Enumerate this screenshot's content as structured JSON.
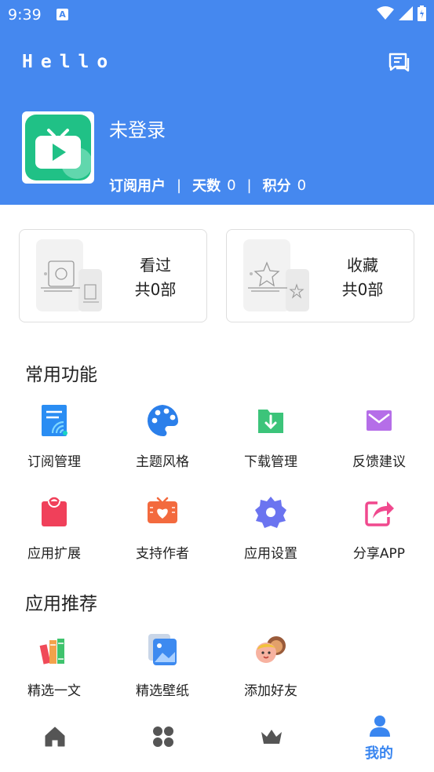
{
  "status_bar": {
    "time": "9:39",
    "notif": "A"
  },
  "header": {
    "title": "Hello",
    "user": {
      "name": "未登录"
    },
    "stats": {
      "type_label": "订阅用户",
      "days_label": "天数",
      "days_value": "0",
      "points_label": "积分",
      "points_value": "0"
    }
  },
  "cards": [
    {
      "title": "看过",
      "count": "共0部"
    },
    {
      "title": "收藏",
      "count": "共0部"
    }
  ],
  "common_functions": {
    "title": "常用功能",
    "items": [
      {
        "label": "订阅管理",
        "icon": "subscription-icon"
      },
      {
        "label": "主题风格",
        "icon": "palette-icon"
      },
      {
        "label": "下载管理",
        "icon": "download-folder-icon"
      },
      {
        "label": "反馈建议",
        "icon": "mail-icon"
      },
      {
        "label": "应用扩展",
        "icon": "bag-icon"
      },
      {
        "label": "支持作者",
        "icon": "heart-tv-icon"
      },
      {
        "label": "应用设置",
        "icon": "settings-gear-icon"
      },
      {
        "label": "分享APP",
        "icon": "share-icon"
      }
    ]
  },
  "recommend": {
    "title": "应用推荐",
    "items": [
      {
        "label": "精选一文",
        "icon": "books-icon"
      },
      {
        "label": "精选壁纸",
        "icon": "wallpaper-icon"
      },
      {
        "label": "添加好友",
        "icon": "friends-icon"
      }
    ]
  },
  "tabbar": {
    "items": [
      {
        "name": "home",
        "label": ""
      },
      {
        "name": "apps",
        "label": ""
      },
      {
        "name": "vip",
        "label": ""
      },
      {
        "name": "me",
        "label": "我的"
      }
    ],
    "active_color": "#3a86f0"
  },
  "colors": {
    "brand": "#4588ef"
  }
}
